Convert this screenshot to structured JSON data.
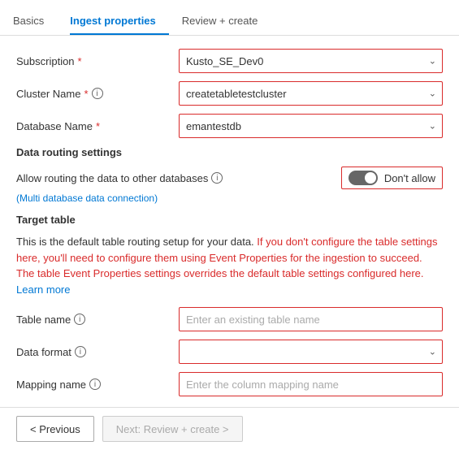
{
  "tabs": [
    {
      "id": "basics",
      "label": "Basics",
      "active": false
    },
    {
      "id": "ingest",
      "label": "Ingest properties",
      "active": true
    },
    {
      "id": "review",
      "label": "Review + create",
      "active": false
    }
  ],
  "form": {
    "subscription": {
      "label": "Subscription",
      "required": true,
      "value": "Kusto_SE_Dev0"
    },
    "clusterName": {
      "label": "Cluster Name",
      "required": true,
      "value": "createtabletestcluster"
    },
    "databaseName": {
      "label": "Database Name",
      "required": true,
      "value": "emantestdb"
    }
  },
  "dataRouting": {
    "sectionTitle": "Data routing settings",
    "routingLabel": "Allow routing the data to other databases",
    "multiDbNote": "(Multi database data connection)",
    "toggleState": "off",
    "toggleLabel": "Don't allow"
  },
  "targetTable": {
    "sectionTitle": "Target table",
    "description1": "This is the default table routing setup for your data.",
    "description2": "If you don't configure the table settings here, you'll need to configure them using Event Properties for the ingestion to succeed. The table Event Properties settings overrides the default table settings configured here.",
    "learnMoreLabel": "Learn more",
    "tableName": {
      "label": "Table name",
      "placeholder": "Enter an existing table name"
    },
    "dataFormat": {
      "label": "Data format",
      "placeholder": ""
    },
    "mappingName": {
      "label": "Mapping name",
      "placeholder": "Enter the column mapping name"
    }
  },
  "footer": {
    "previousLabel": "< Previous",
    "nextLabel": "Next: Review + create >"
  }
}
